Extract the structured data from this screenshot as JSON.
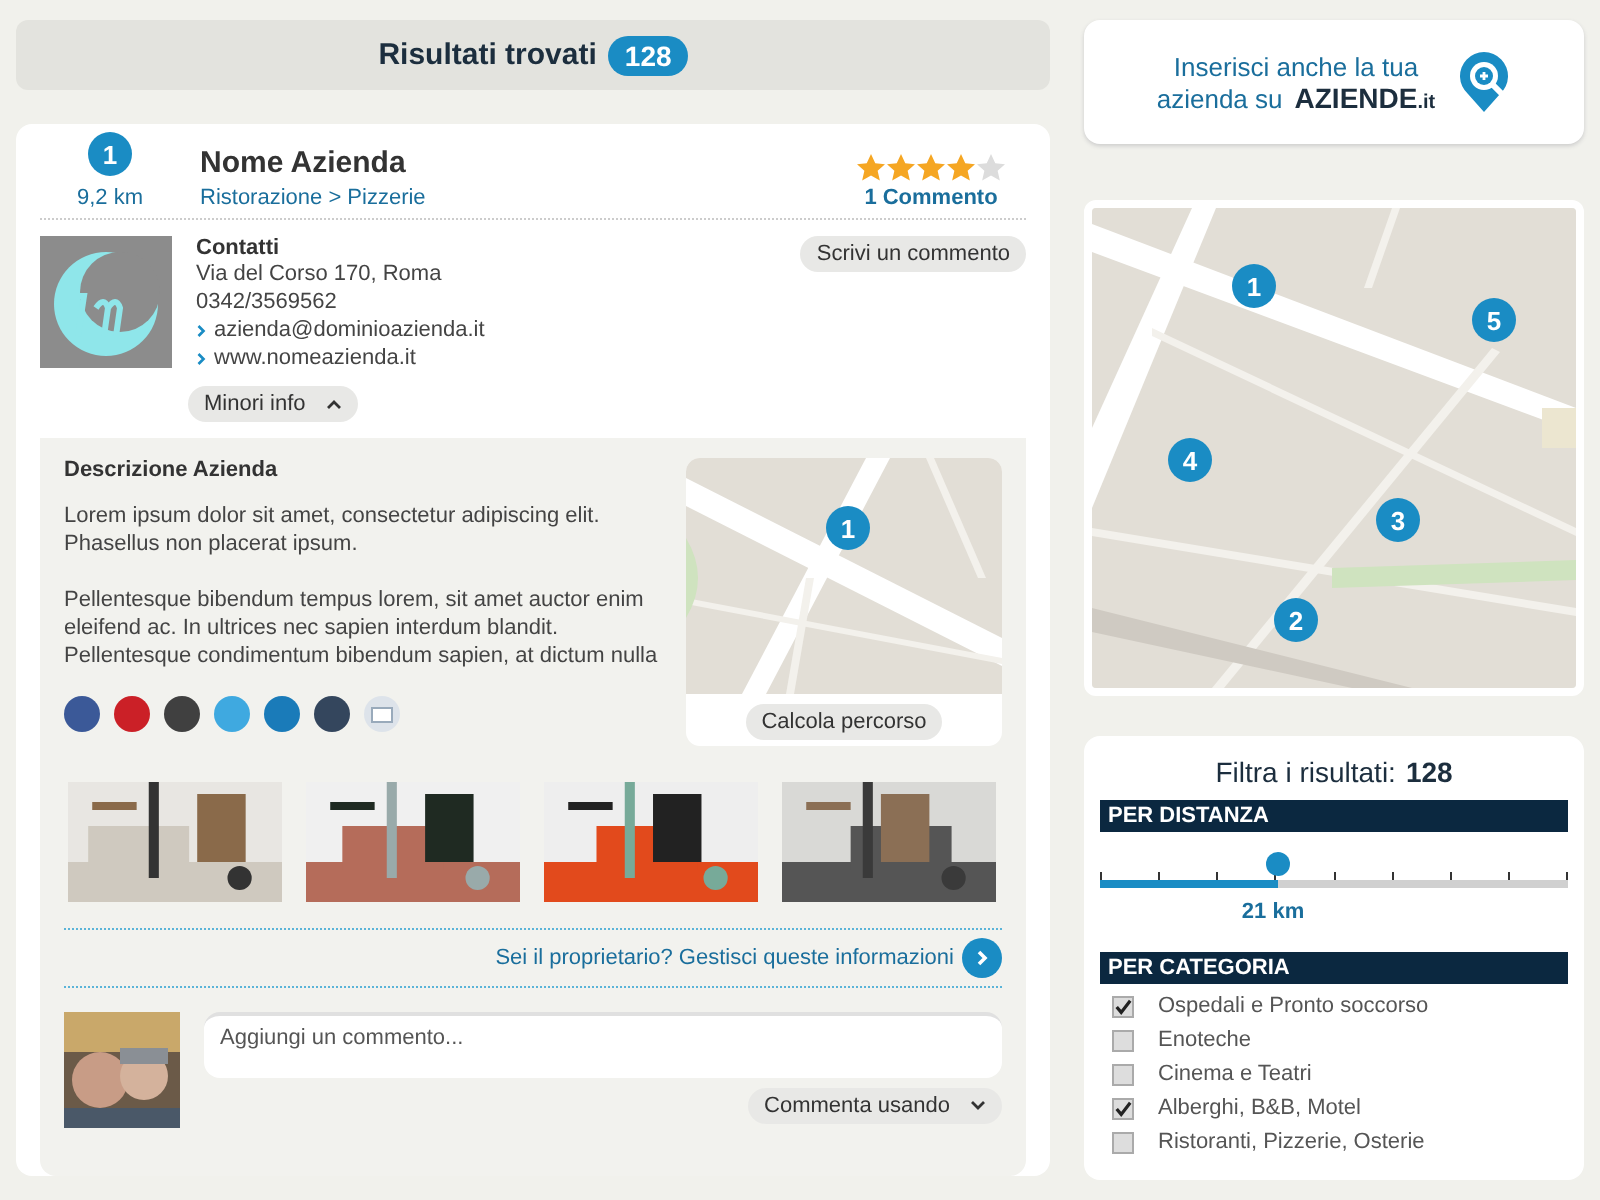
{
  "header": {
    "title": "Risultati trovati",
    "count": "128"
  },
  "listing": {
    "pin": "1",
    "distance": "9,2 km",
    "name": "Nome Azienda",
    "category": "Ristorazione > Pizzerie",
    "stars": 4,
    "comments": "1 Commento",
    "write_comment": "Scrivi un commento",
    "contacts_title": "Contatti",
    "address": "Via del Corso 170, Roma",
    "phone": "0342/3569562",
    "links": [
      "azienda@dominioazienda.it",
      "www.nomeazienda.it"
    ],
    "toggle": {
      "label": "Minori info",
      "expanded": true
    },
    "description_title": "Descrizione Azienda",
    "paragraphs": [
      "Lorem ipsum dolor sit amet, consectetur adipiscing elit. Phasellus non placerat ipsum.",
      "Pellentesque bibendum tempus lorem, sit amet auctor enim eleifend ac. In ultrices nec sapien interdum blandit. Pellentesque condimentum bibendum sapien, at dictum nulla"
    ],
    "social": [
      {
        "kind": "facebook"
      },
      {
        "kind": "pinterest"
      },
      {
        "kind": "googleplus"
      },
      {
        "kind": "twitter"
      },
      {
        "kind": "linkedin"
      },
      {
        "kind": "tumblr"
      },
      {
        "kind": "email"
      }
    ],
    "map_pin": "1",
    "route_button": "Calcola percorso",
    "photos": [
      {
        "kind": "picture"
      },
      {
        "kind": "picture"
      },
      {
        "kind": "picture"
      },
      {
        "kind": "picture"
      }
    ],
    "owner_link": "Sei il proprietario? Gestisci queste informazioni",
    "comment_placeholder": "Aggiungi un commento...",
    "comment_with": "Commenta usando"
  },
  "promo": {
    "line1": "Inserisci anche la tua",
    "line2": "azienda su",
    "brand": "AZIENDE",
    "brand_suffix": ".it"
  },
  "map_pins": [
    "1",
    "5",
    "4",
    "3",
    "2"
  ],
  "filter": {
    "title": "Filtra i risultati:",
    "count": "128",
    "distance_heading": "PER DISTANZA",
    "distance": {
      "level": 0.38,
      "reading": "21 km"
    },
    "category_heading": "PER CATEGORIA",
    "categories": [
      {
        "label": "Ospedali e Pronto soccorso",
        "checked": true
      },
      {
        "label": "Enoteche",
        "checked": false
      },
      {
        "label": "Cinema e Teatri",
        "checked": false
      },
      {
        "label": "Alberghi, B&B, Motel",
        "checked": true
      },
      {
        "label": "Ristoranti, Pizzerie, Osterie",
        "checked": false
      }
    ]
  }
}
